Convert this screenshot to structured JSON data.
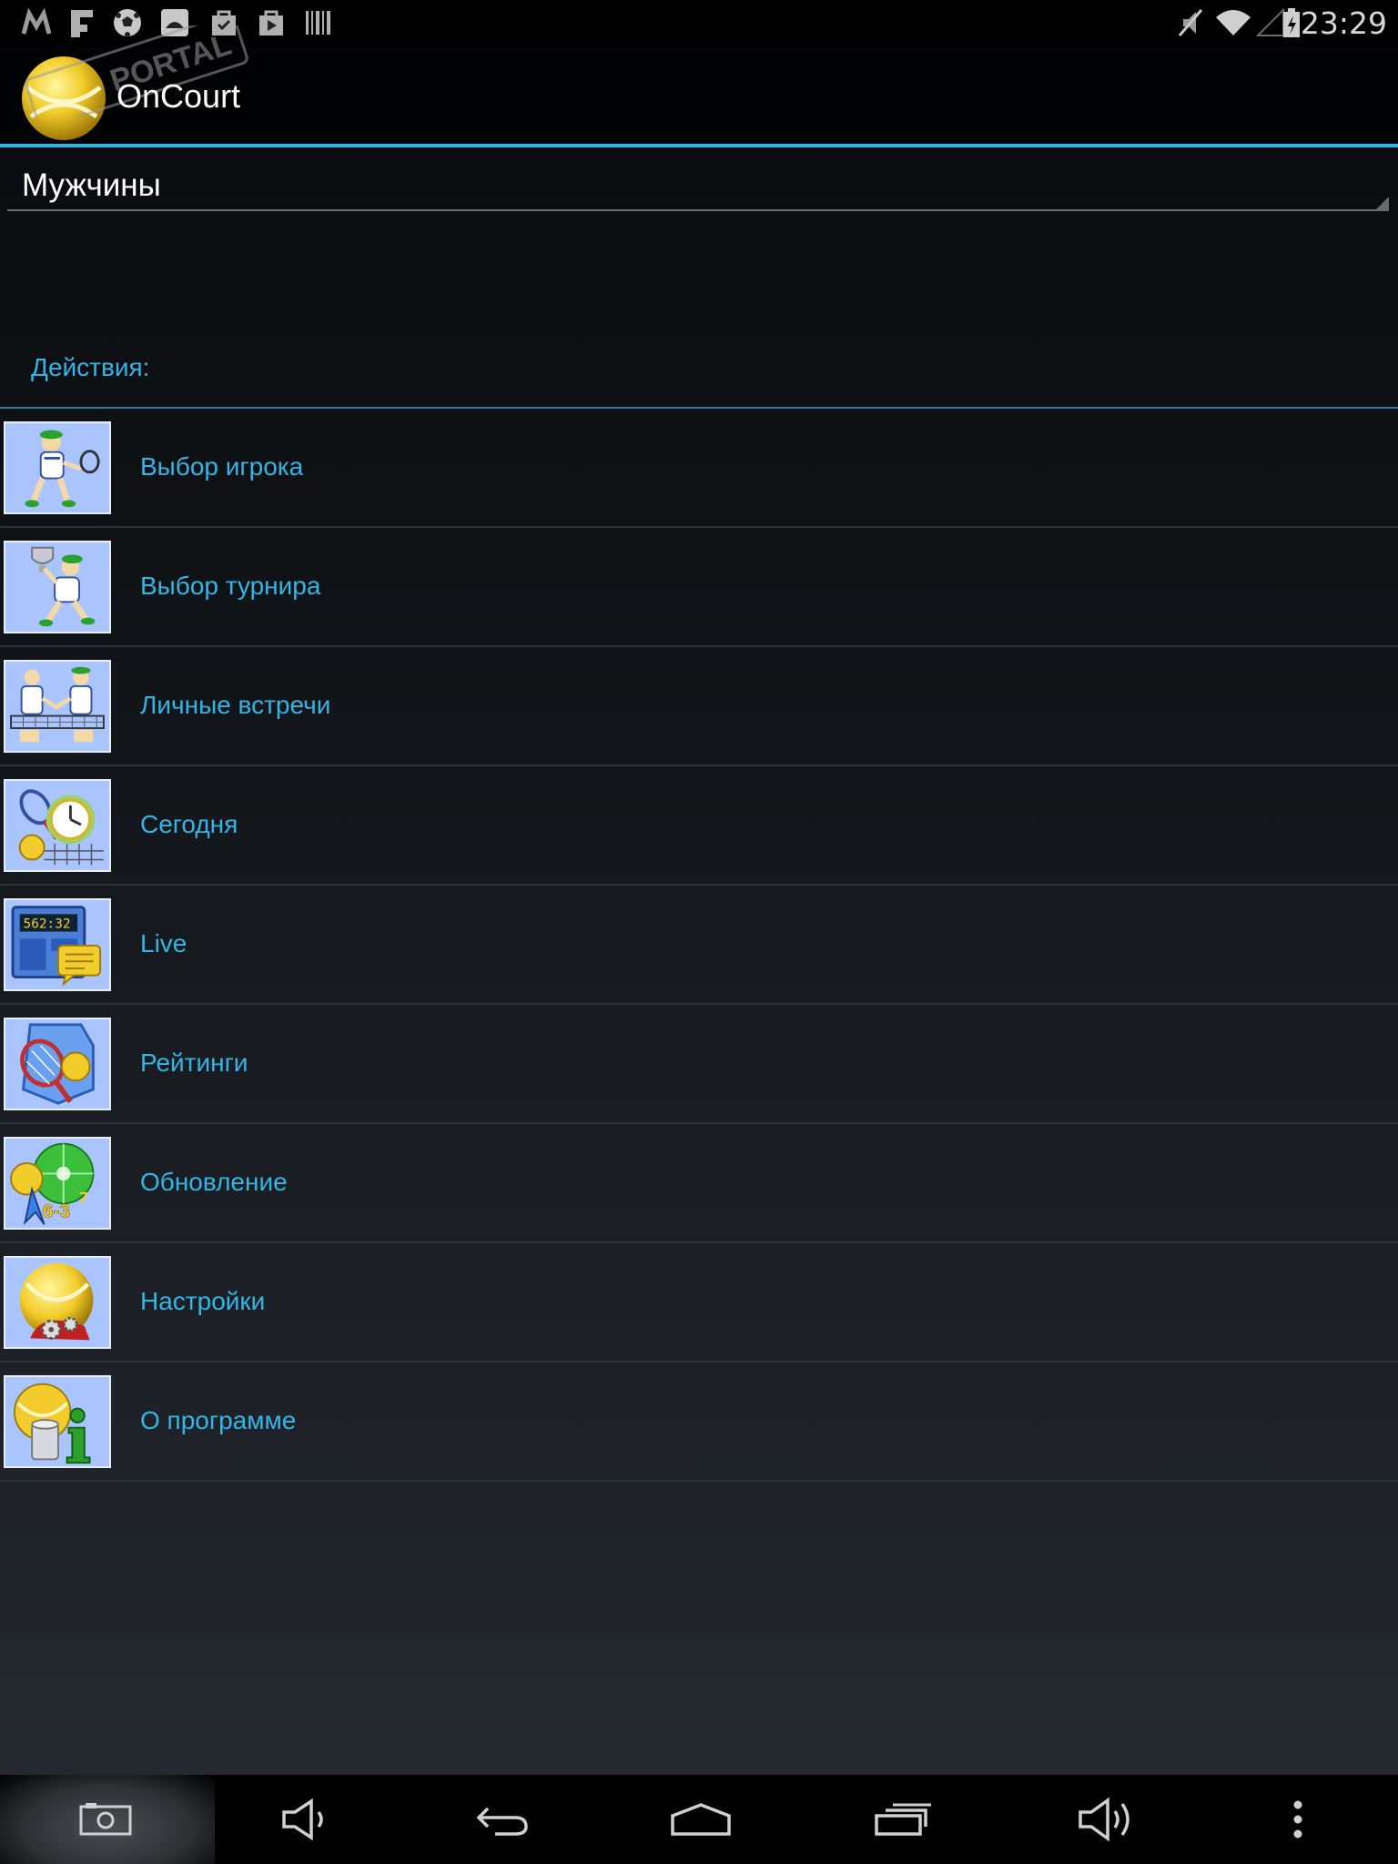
{
  "status_bar": {
    "time": "23:29",
    "left_icons": [
      "motorola-icon",
      "flipboard-icon",
      "soccer-ball-icon",
      "photo-icon",
      "shopping-bag-icon",
      "play-store-icon",
      "barcode-icon"
    ],
    "right_icons": [
      "mute-icon",
      "wifi-icon",
      "signal-icon",
      "battery-icon"
    ]
  },
  "action_bar": {
    "title": "OnCourt",
    "watermark": "PORTAL"
  },
  "spinner": {
    "selected": "Мужчины"
  },
  "section": {
    "header": "Действия:"
  },
  "actions": [
    {
      "label": "Выбор игрока",
      "icon": "tennis-player-icon"
    },
    {
      "label": "Выбор турнира",
      "icon": "trophy-player-icon"
    },
    {
      "label": "Личные встречи",
      "icon": "head-to-head-icon"
    },
    {
      "label": "Сегодня",
      "icon": "clock-icon"
    },
    {
      "label": "Live",
      "icon": "scoreboard-icon"
    },
    {
      "label": "Рейтинги",
      "icon": "rankings-icon"
    },
    {
      "label": "Обновление",
      "icon": "update-icon"
    },
    {
      "label": "Настройки",
      "icon": "settings-icon"
    },
    {
      "label": "О программе",
      "icon": "about-icon"
    }
  ],
  "nav_bar": {
    "buttons": [
      "screenshot-icon",
      "volume-down-icon",
      "back-icon",
      "home-icon",
      "recents-icon",
      "volume-up-icon",
      "menu-icon"
    ]
  },
  "colors": {
    "accent": "#33b5e5",
    "icon_background": "#a9c4ff"
  }
}
